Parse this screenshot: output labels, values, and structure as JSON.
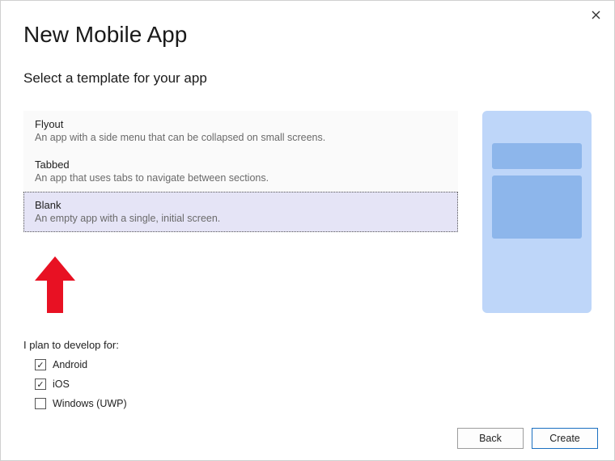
{
  "title": "New Mobile App",
  "subtitle": "Select a template for your app",
  "templates": [
    {
      "name": "Flyout",
      "desc": "An app with a side menu that can be collapsed on small screens."
    },
    {
      "name": "Tabbed",
      "desc": "An app that uses tabs to navigate between sections."
    },
    {
      "name": "Blank",
      "desc": "An empty app with a single, initial screen."
    }
  ],
  "selected_template_index": 2,
  "develop_label": "I plan to develop for:",
  "platforms": [
    {
      "label": "Android",
      "checked": true
    },
    {
      "label": "iOS",
      "checked": true
    },
    {
      "label": "Windows (UWP)",
      "checked": false
    }
  ],
  "buttons": {
    "back": "Back",
    "create": "Create"
  }
}
